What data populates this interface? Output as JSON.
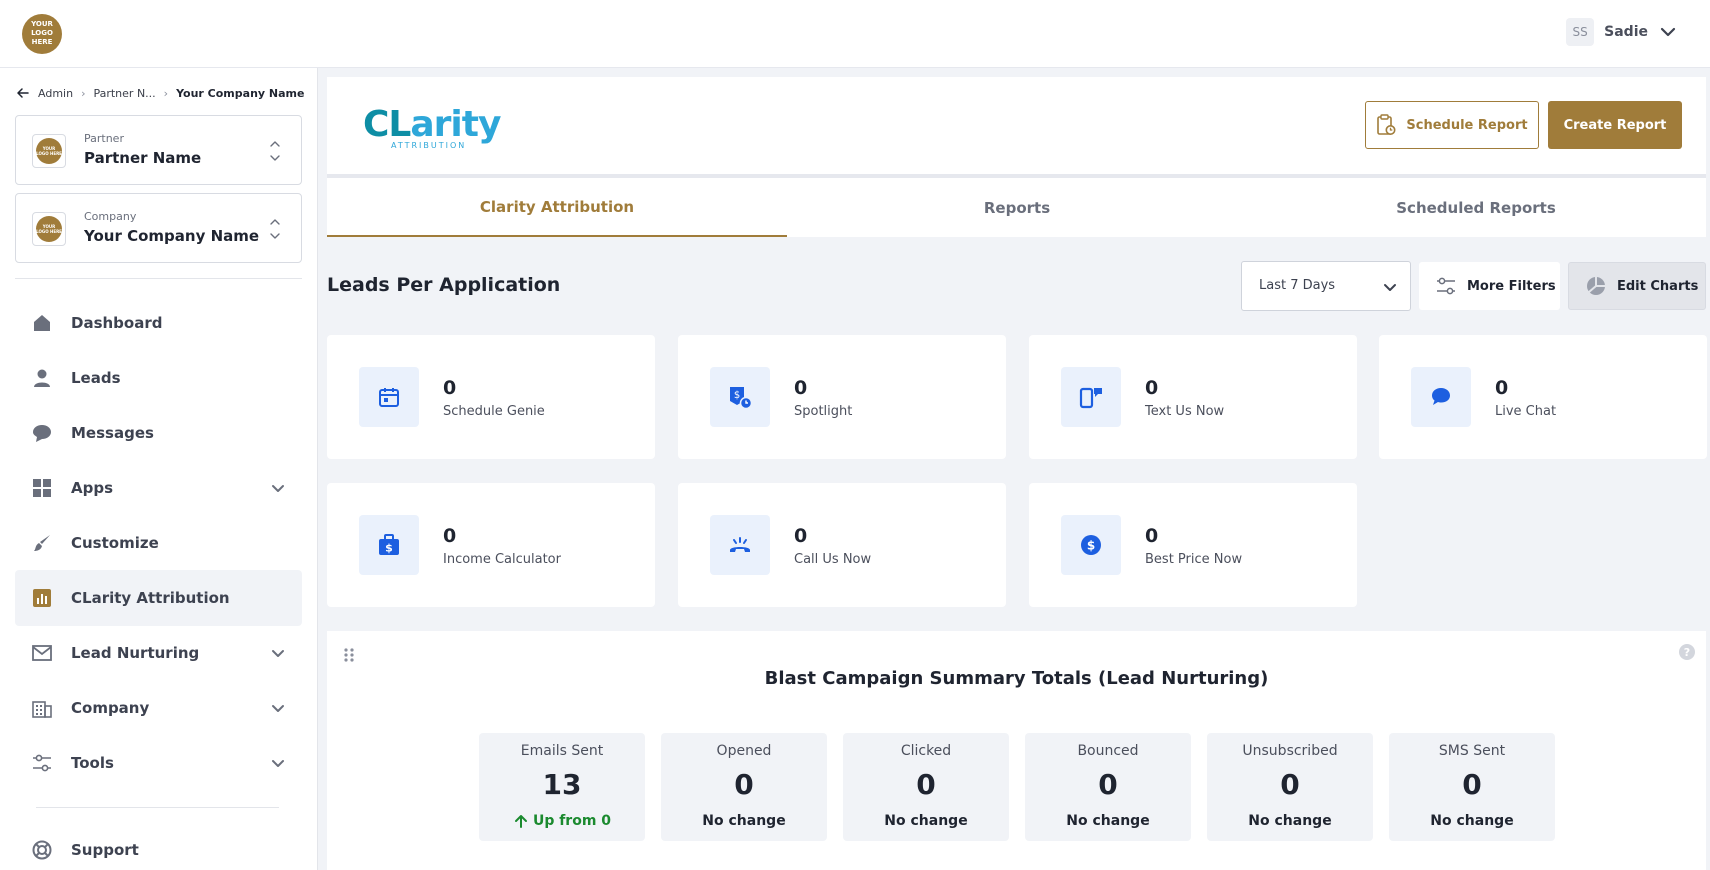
{
  "header": {
    "logo_text": "YOUR LOGO HERE",
    "user_initials": "SS",
    "user_name": "Sadie"
  },
  "breadcrumb": {
    "items": [
      "Admin",
      "Partner N...",
      "Your Company Name"
    ]
  },
  "partner_selector": {
    "label": "Partner",
    "value": "Partner Name",
    "logo_text": "YOUR LOGO HERE"
  },
  "company_selector": {
    "label": "Company",
    "value": "Your Company Name",
    "logo_text": "YOUR LOGO HERE"
  },
  "sidebar": {
    "items": [
      {
        "label": "Dashboard",
        "icon": "home-icon"
      },
      {
        "label": "Leads",
        "icon": "person-icon"
      },
      {
        "label": "Messages",
        "icon": "chat-bubble-icon"
      },
      {
        "label": "Apps",
        "icon": "grid-icon",
        "expandable": true
      },
      {
        "label": "Customize",
        "icon": "paintbrush-icon"
      },
      {
        "label": "CLarity Attribution",
        "icon": "bar-chart-icon",
        "active": true
      },
      {
        "label": "Lead Nurturing",
        "icon": "envelope-icon",
        "expandable": true
      },
      {
        "label": "Company",
        "icon": "building-icon",
        "expandable": true
      },
      {
        "label": "Tools",
        "icon": "sliders-icon",
        "expandable": true
      },
      {
        "label": "Support",
        "icon": "lifebuoy-icon"
      }
    ]
  },
  "brand": {
    "name_part1": "CL",
    "name_part2": "arity",
    "sub": "ATTRIBUTION"
  },
  "actions": {
    "schedule_report": "Schedule Report",
    "create_report": "Create Report"
  },
  "tabs": [
    {
      "label": "Clarity Attribution",
      "active": true
    },
    {
      "label": "Reports"
    },
    {
      "label": "Scheduled Reports"
    }
  ],
  "section": {
    "title": "Leads Per Application",
    "date_range": "Last 7 Days",
    "more_filters": "More Filters",
    "edit_charts": "Edit Charts"
  },
  "apps": [
    {
      "count": "0",
      "label": "Schedule Genie",
      "icon": "calendar-icon"
    },
    {
      "count": "0",
      "label": "Spotlight",
      "icon": "spotlight-icon"
    },
    {
      "count": "0",
      "label": "Text Us Now",
      "icon": "mobile-message-icon"
    },
    {
      "count": "0",
      "label": "Live Chat",
      "icon": "chat-icon"
    },
    {
      "count": "0",
      "label": "Income Calculator",
      "icon": "briefcase-dollar-icon"
    },
    {
      "count": "0",
      "label": "Call Us Now",
      "icon": "phone-icon"
    },
    {
      "count": "0",
      "label": "Best Price Now",
      "icon": "dollar-circle-icon"
    }
  ],
  "blast": {
    "title": "Blast Campaign Summary Totals (Lead Nurturing)",
    "stats": [
      {
        "label": "Emails Sent",
        "value": "13",
        "change": "Up from 0",
        "trend": "up"
      },
      {
        "label": "Opened",
        "value": "0",
        "change": "No change"
      },
      {
        "label": "Clicked",
        "value": "0",
        "change": "No change"
      },
      {
        "label": "Bounced",
        "value": "0",
        "change": "No change"
      },
      {
        "label": "Unsubscribed",
        "value": "0",
        "change": "No change"
      },
      {
        "label": "SMS Sent",
        "value": "0",
        "change": "No change"
      }
    ]
  },
  "colors": {
    "accent": "#a07c3a",
    "icon_blue": "#1d5fe0",
    "positive": "#1b8a2f"
  }
}
